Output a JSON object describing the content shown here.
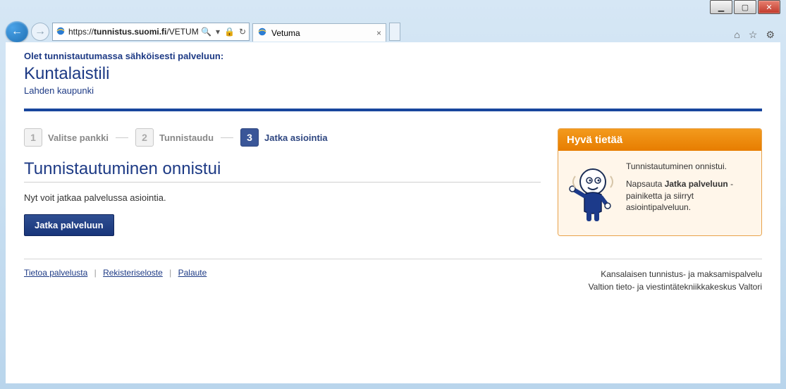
{
  "browser": {
    "url_prefix": "https://",
    "url_host": "tunnistus.suomi.fi",
    "url_path": "/VETUMA",
    "tab_title": "Vetuma",
    "search_glyph": "🔍",
    "refresh_glyph": "↻",
    "lock_glyph": "🔒",
    "dropdown_glyph": "▾",
    "close_tab_glyph": "×",
    "home_glyph": "⌂",
    "star_glyph": "☆",
    "gear_glyph": "⚙",
    "back_glyph": "←",
    "fwd_glyph": "→",
    "min_glyph": "▁",
    "max_glyph": "▢",
    "winclose_glyph": "✕"
  },
  "header": {
    "intro": "Olet tunnistautumassa sähköisesti palveluun:",
    "service": "Kuntalaistili",
    "org": "Lahden kaupunki"
  },
  "steps": [
    {
      "num": "1",
      "label": "Valitse pankki",
      "active": false
    },
    {
      "num": "2",
      "label": "Tunnistaudu",
      "active": false
    },
    {
      "num": "3",
      "label": "Jatka asiointia",
      "active": true
    }
  ],
  "main": {
    "heading": "Tunnistautuminen onnistui",
    "body": "Nyt voit jatkaa palvelussa asiointia.",
    "button": "Jatka palveluun"
  },
  "info": {
    "title": "Hyvä tietää",
    "line1": "Tunnistautuminen onnistui.",
    "line2a": "Napsauta ",
    "line2b": "Jatka palveluun",
    "line2c": " -painiketta ja siirryt asiointipalveluun."
  },
  "footer": {
    "links": [
      "Tietoa palvelusta",
      "Rekisteriseloste",
      "Palaute"
    ],
    "sep": "|",
    "right1": "Kansalaisen tunnistus- ja maksamispalvelu",
    "right2": "Valtion tieto- ja viestintätekniikkakeskus Valtori"
  }
}
